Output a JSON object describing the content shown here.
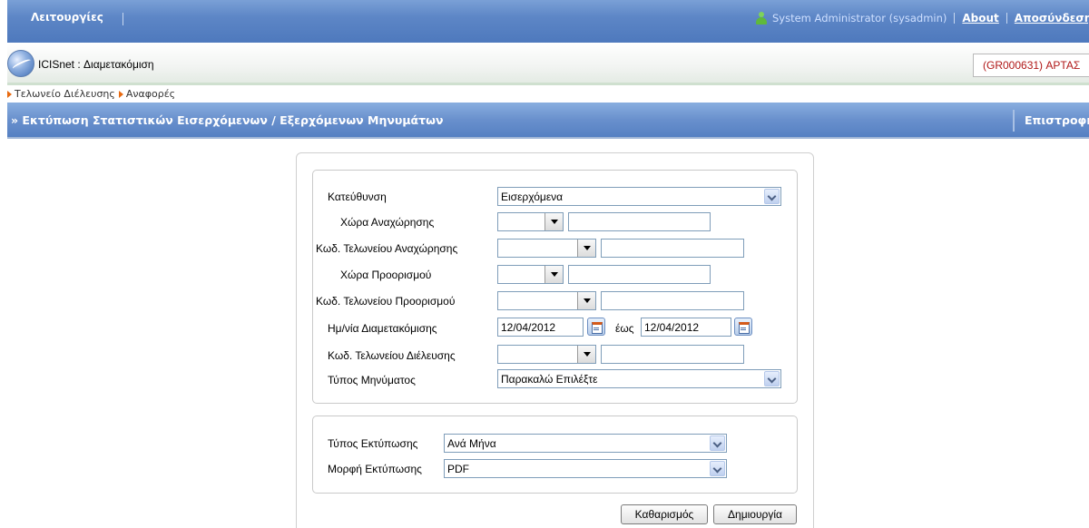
{
  "topbar": {
    "menu_label": "Λειτουργίες",
    "user": "System Administrator (sysadmin)",
    "about": "About",
    "logout": "Αποσύνδεση"
  },
  "app": {
    "title": "ICISnet : Διαμετακόμιση",
    "office": "(GR000631) ΑΡΤΑΣ"
  },
  "breadcrumb": {
    "items": [
      "Τελωνείο Διέλευσης",
      "Αναφορές"
    ]
  },
  "section": {
    "title": "» Εκτύπωση Στατιστικών Εισερχόμενων / Εξερχόμενων Μηνυμάτων",
    "back": "Επιστροφή"
  },
  "form": {
    "direction": {
      "label": "Κατεύθυνση",
      "value": "Εισερχόμενα"
    },
    "departure_country": {
      "label": "Χώρα Αναχώρησης",
      "value": "",
      "text": ""
    },
    "departure_office": {
      "label": "Κωδ. Τελωνείου Αναχώρησης",
      "value": "",
      "text": ""
    },
    "destination_country": {
      "label": "Χώρα Προορισμού",
      "value": "",
      "text": ""
    },
    "destination_office": {
      "label": "Κωδ. Τελωνείου Προορισμού",
      "value": "",
      "text": ""
    },
    "transit_date": {
      "label": "Ημ/νία Διαμετακόμισης",
      "from": "12/04/2012",
      "to_label": "έως",
      "to": "12/04/2012"
    },
    "transit_office": {
      "label": "Κωδ. Τελωνείου Διέλευσης",
      "value": "",
      "text": ""
    },
    "message_type": {
      "label": "Τύπος Μηνύματος",
      "value": "Παρακαλώ Επιλέξτε"
    },
    "print_type": {
      "label": "Τύπος Εκτύπωσης",
      "value": "Ανά Μήνα"
    },
    "print_format": {
      "label": "Μορφή Εκτύπωσης",
      "value": "PDF"
    }
  },
  "buttons": {
    "clear": "Καθαρισμός",
    "create": "Δημιουργία"
  }
}
